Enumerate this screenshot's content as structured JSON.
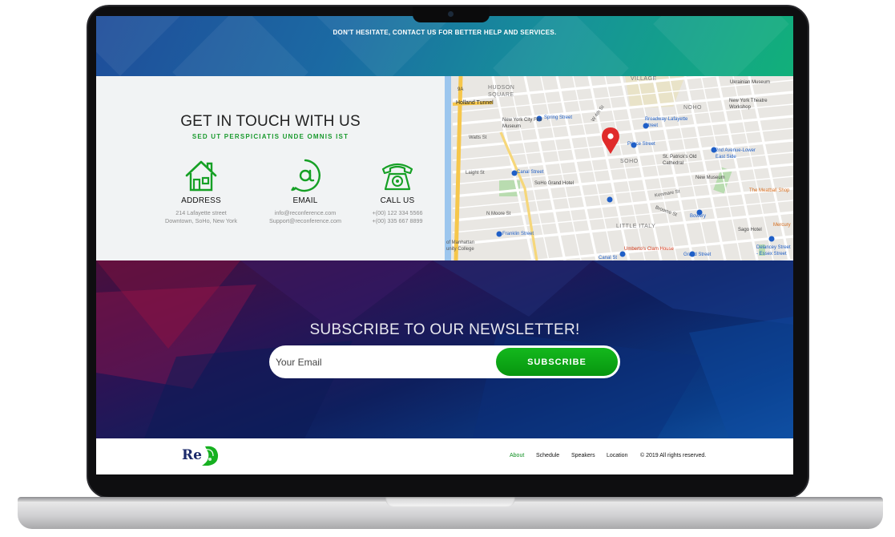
{
  "top": {
    "text": "DON'T HESITATE, CONTACT US FOR BETTER HELP AND SERVICES."
  },
  "contact": {
    "title": "GET IN TOUCH WITH US",
    "subtitle": "SED UT PERSPICIATIS UNDE OMNIS IST",
    "address": {
      "label": "ADDRESS",
      "line1": "214 Lafayette street",
      "line2": "Downtown, SoHo, New York"
    },
    "email": {
      "label": "EMAIL",
      "line1": "info@reconference.com",
      "line2": "Support@reconference.com"
    },
    "call": {
      "label": "CALL US",
      "line1": "+(00) 122 334 5566",
      "line2": "+(00) 335 667 8899"
    }
  },
  "map": {
    "labels": {
      "hudson_square": "HUDSON SQUARE",
      "holland_tunnel": "Holland Tunnel",
      "nyc_fire_museum": "New York City Fire Museum",
      "spring_st": "Spring Street",
      "canal_st": "Canal Street",
      "soho_grand": "SoHo Grand Hotel",
      "franklin_st": "Franklin Street",
      "prince_st": "Prince Street",
      "broadway_lafayette": "Broadway-Lafayette Street",
      "noho": "NOHO",
      "soho": "SOHO",
      "little_italy": "LITTLE ITALY",
      "village": "VILLAGE",
      "ukrainian": "Ukrainian Museum",
      "ny_theatre": "New York Theatre Workshop",
      "second_ave": "2nd Avenue-Lower East Side",
      "st_patrick": "St. Patrick's Old Cathedral",
      "new_museum": "New Museum",
      "meatball": "The Meatball Shop",
      "bowery": "Bowery",
      "sago": "Sago Hotel",
      "mercury": "Mercury",
      "delancey": "Delancey Street - Essex Street",
      "umberto": "Umberto's Clam House",
      "grand_st": "Grand Street",
      "manhattan_college": "of Manhattan unity College",
      "watts": "Watts St",
      "laight": "Laight St",
      "moore": "N Moore St",
      "canal_label": "Canal St",
      "w_4th": "W 4th St",
      "kenmare": "Kenmare St",
      "broome": "Broome St",
      "route_9a": "9A"
    }
  },
  "newsletter": {
    "title": "SUBSCRIBE TO OUR NEWSLETTER!",
    "placeholder": "Your Email",
    "button": "SUBSCRIBE"
  },
  "footer": {
    "logo_text": "Re",
    "nav": [
      "About",
      "Schedule",
      "Speakers",
      "Location"
    ],
    "copyright": "© 2019 All rights reserved."
  },
  "colors": {
    "accent": "#0d9a1e",
    "topbar_start": "#1f4d9a",
    "topbar_end": "#12b07a",
    "pin": "#e02b2b"
  }
}
